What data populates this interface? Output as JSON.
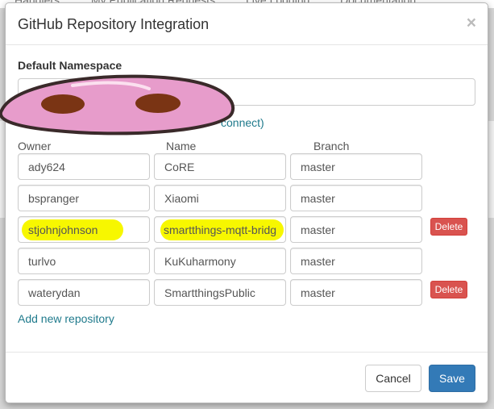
{
  "background_nav": [
    "Handlers",
    "My Publication Requests",
    "Live Logging",
    "Documentation"
  ],
  "modal": {
    "title": "GitHub Repository Integration",
    "close_glyph": "×"
  },
  "namespace": {
    "label": "Default Namespace",
    "value": "",
    "placeholder": ""
  },
  "help": {
    "prefix": "",
    "link_text": "connect)"
  },
  "columns": {
    "owner": "Owner",
    "name": "Name",
    "branch": "Branch"
  },
  "repositories": [
    {
      "owner": "ady624",
      "name": "CoRE",
      "branch": "master",
      "highlighted": false,
      "delete_label": ""
    },
    {
      "owner": "bspranger",
      "name": "Xiaomi",
      "branch": "master",
      "highlighted": false,
      "delete_label": ""
    },
    {
      "owner": "stjohnjohnson",
      "name": "smartthings-mqtt-bridg",
      "branch": "master",
      "highlighted": true,
      "delete_label": "Delete"
    },
    {
      "owner": "turlvo",
      "name": "KuKuharmony",
      "branch": "master",
      "highlighted": false,
      "delete_label": ""
    },
    {
      "owner": "waterydan",
      "name": "SmartthingsPublic",
      "branch": "master",
      "highlighted": false,
      "delete_label": "Delete"
    }
  ],
  "add_repository_label": "Add new repository",
  "footer": {
    "cancel_label": "Cancel",
    "save_label": "Save"
  },
  "colors": {
    "primary": "#337ab7",
    "danger": "#d9534f",
    "link": "#1f7a8c",
    "highlight": "#f7f700",
    "redaction_blob": "#e79ccb"
  }
}
